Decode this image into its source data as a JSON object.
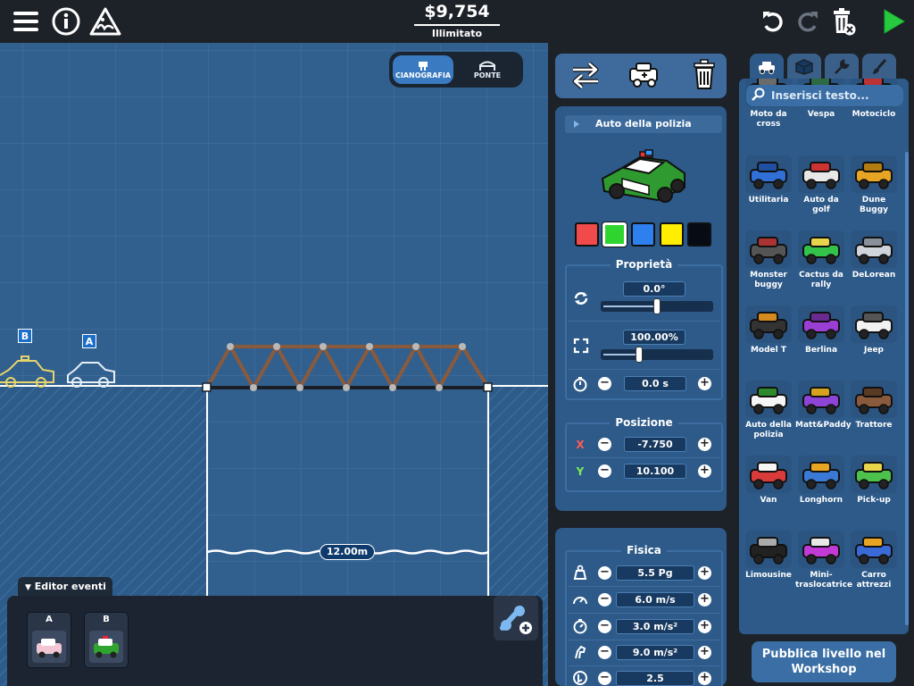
{
  "topbar": {
    "money": "$9,754",
    "budget_label": "Illimitato",
    "icons": [
      "menu-icon",
      "info-icon",
      "stress-icon",
      "undo-icon",
      "redo-icon",
      "delete-icon",
      "play-icon"
    ]
  },
  "canvas": {
    "view_toggle": {
      "blueprint": "CIANOGRAFIA",
      "bridge": "PONTE"
    },
    "markers": {
      "a": "A",
      "b": "B"
    },
    "span_length": "12.00m"
  },
  "events": {
    "title": "Editor eventi",
    "slots": [
      {
        "label": "A"
      },
      {
        "label": "B"
      }
    ]
  },
  "vehicle_panel": {
    "name": "Auto della polizia",
    "colors": [
      "#f04a4a",
      "#2fd42f",
      "#2e80ef",
      "#ffee00",
      "#070b14"
    ],
    "selected_color_index": 1,
    "properties": {
      "title": "Proprietà",
      "rotation": "0.0°",
      "rotation_slider": 0.5,
      "scale": "100.00%",
      "scale_slider": 0.33,
      "delay": "0.0 s"
    },
    "position": {
      "title": "Posizione",
      "x_label": "X",
      "x": "-7.750",
      "y_label": "Y",
      "y": "10.100"
    }
  },
  "physics": {
    "title": "Fisica",
    "mass": "5.5 Pg",
    "speed": "6.0 m/s",
    "acceleration": "3.0 m/s²",
    "deceleration": "9.0 m/s²",
    "last": "2.5"
  },
  "catalog": {
    "search_placeholder": "Inserisci testo...",
    "items": [
      {
        "name": "Moto da cross"
      },
      {
        "name": "Vespa"
      },
      {
        "name": "Motociclo"
      },
      {
        "name": "Utilitaria"
      },
      {
        "name": "Auto da golf"
      },
      {
        "name": "Dune Buggy"
      },
      {
        "name": "Monster buggy"
      },
      {
        "name": "Cactus da rally"
      },
      {
        "name": "DeLorean"
      },
      {
        "name": "Model T"
      },
      {
        "name": "Berlina"
      },
      {
        "name": "Jeep"
      },
      {
        "name": "Auto della polizia"
      },
      {
        "name": "Matt&Paddy"
      },
      {
        "name": "Trattore"
      },
      {
        "name": "Van"
      },
      {
        "name": "Longhorn"
      },
      {
        "name": "Pick-up"
      },
      {
        "name": "Limousine"
      },
      {
        "name": "Mini-traslocatrice"
      },
      {
        "name": "Carro attrezzi"
      }
    ],
    "publish_label": "Pubblica livello nel Workshop"
  }
}
